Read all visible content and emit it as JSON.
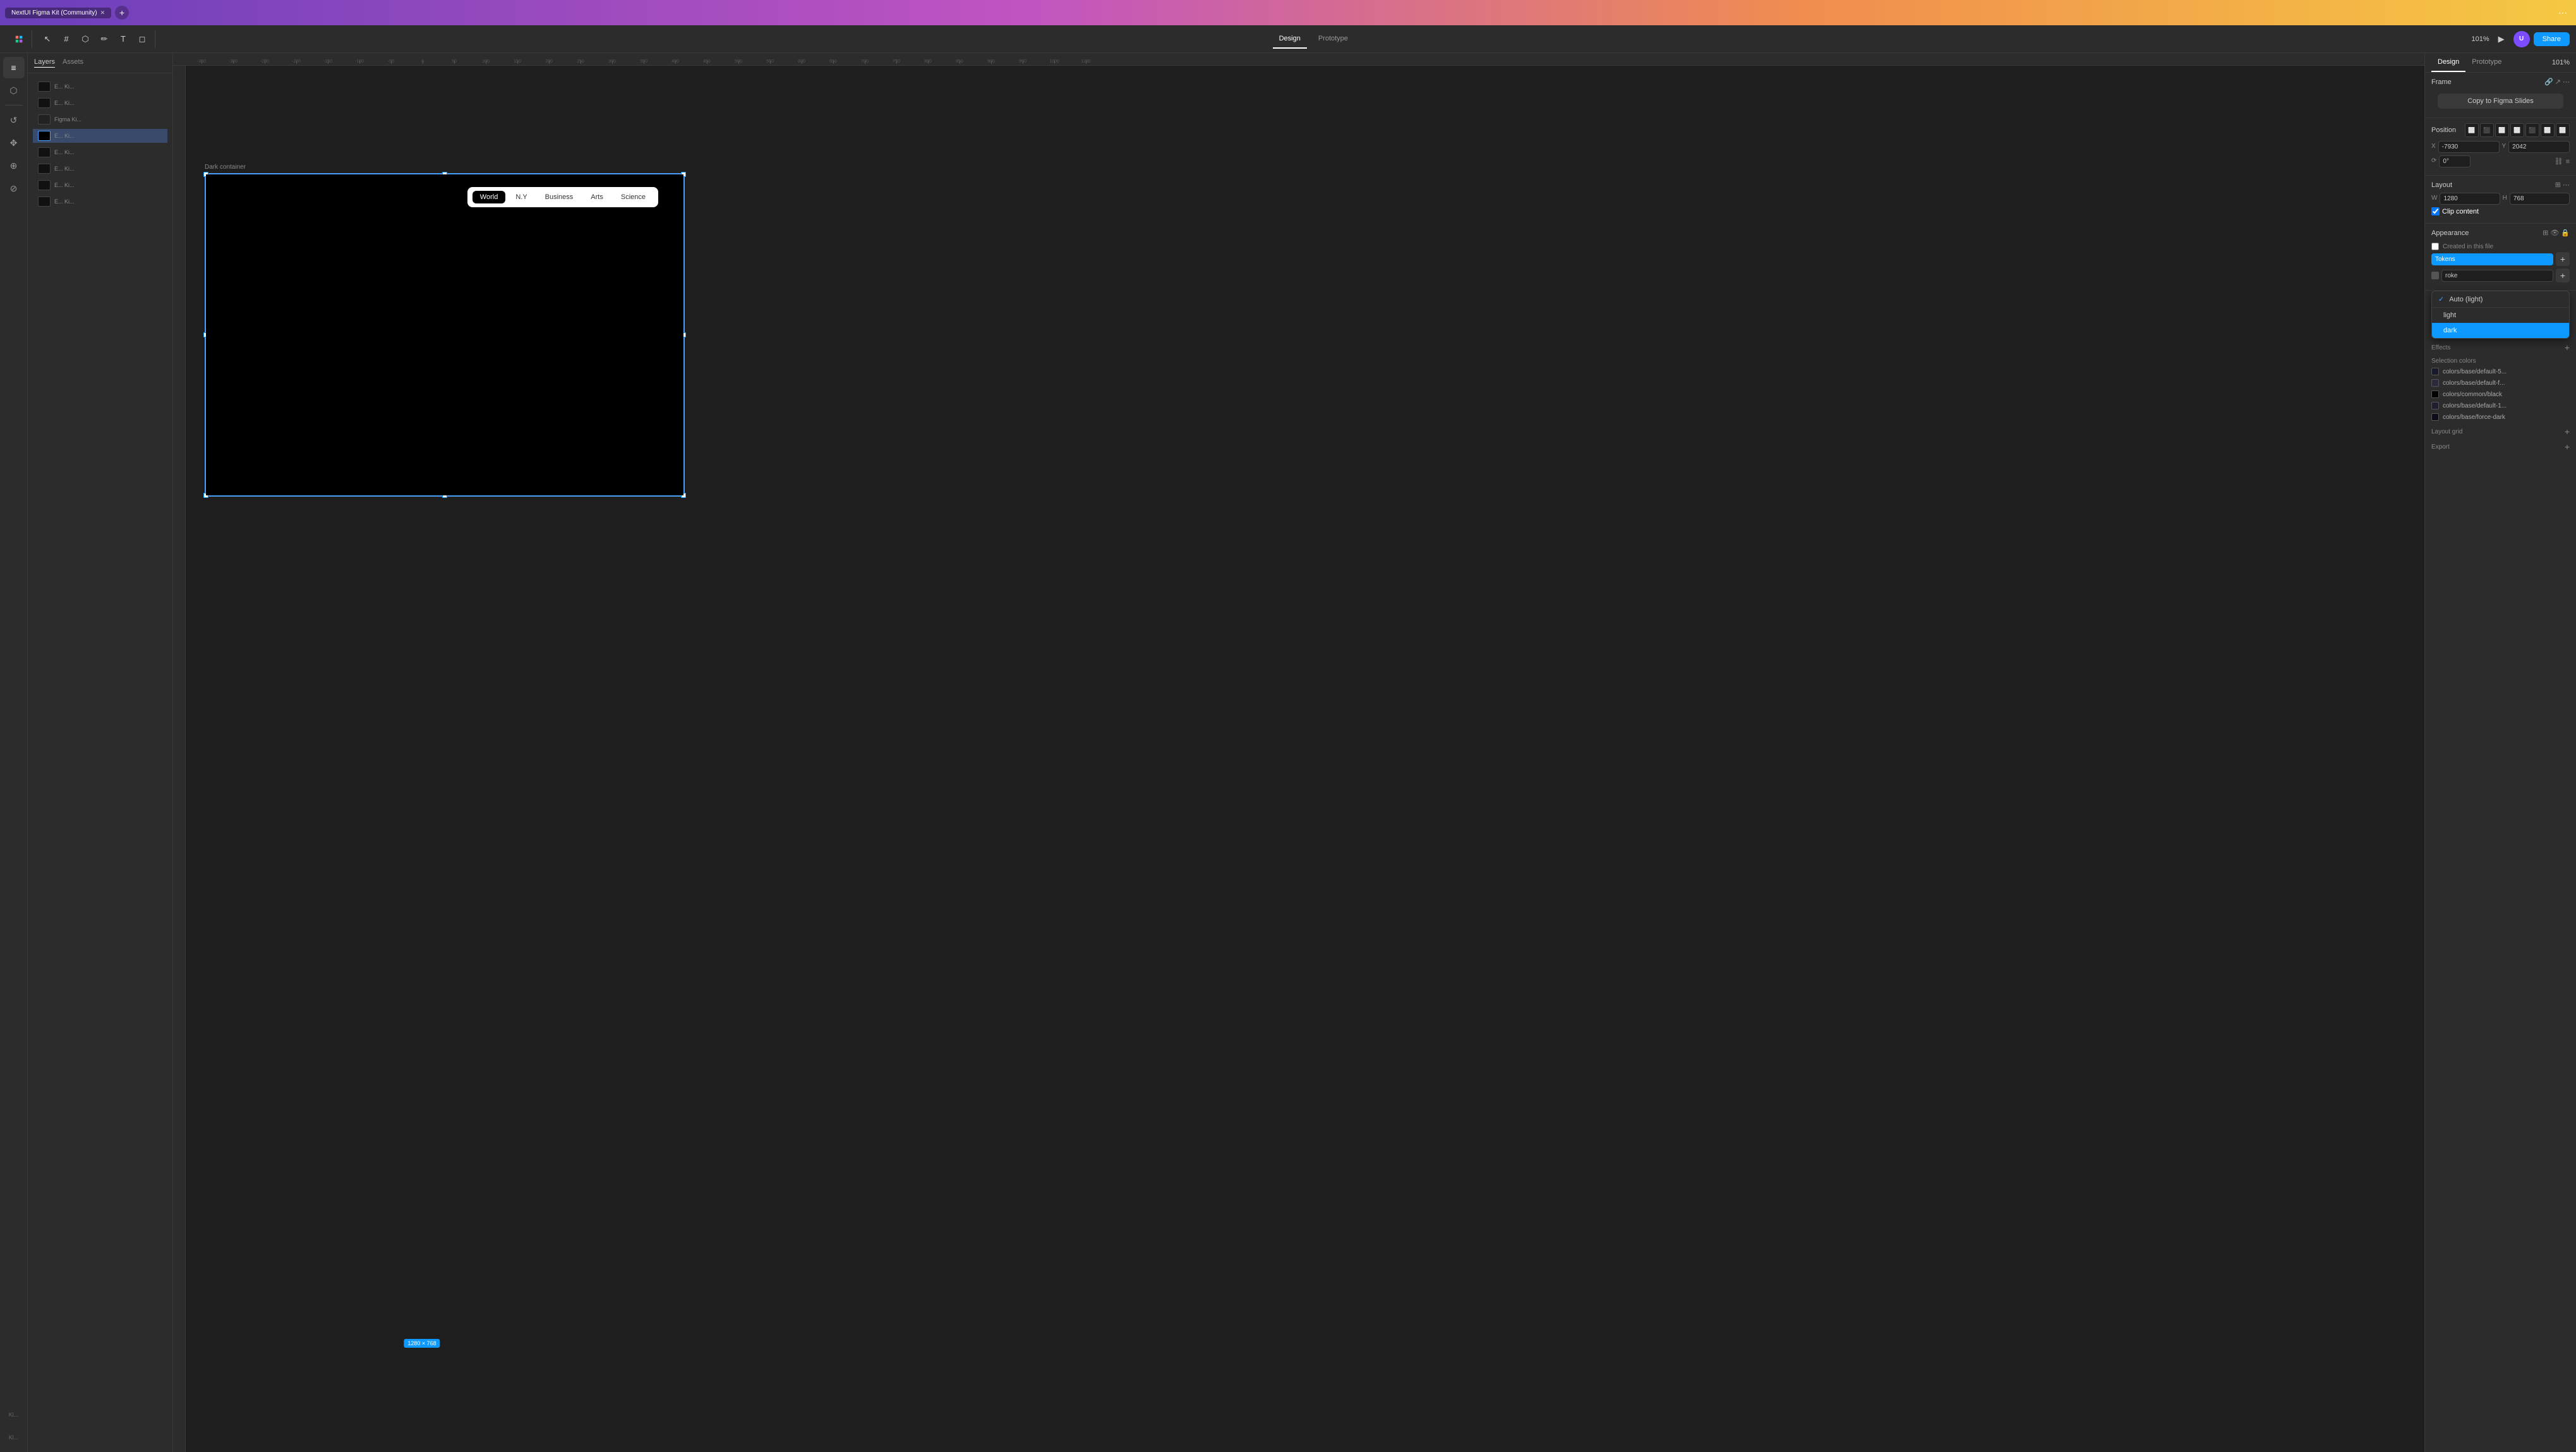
{
  "window": {
    "title": "NextUI Figma Kit (Community)",
    "tab_label": "NextUI Figma Kit (Community)",
    "close_icon": "✕",
    "add_tab_icon": "+"
  },
  "toolbar": {
    "share_label": "Share",
    "zoom_label": "101%",
    "play_icon": "▶",
    "design_tab": "Design",
    "prototype_tab": "Prototype",
    "more_icon": "⋯"
  },
  "left_sidebar": {
    "icons": [
      "≡",
      "⬡",
      "◻",
      "T",
      "✏",
      "⬜"
    ],
    "sub_icons": [
      "↺",
      "✥",
      "⊕",
      "⊘"
    ]
  },
  "layers": {
    "tabs": [
      "Layers",
      "Assets"
    ],
    "items": [
      {
        "label": "E... Ki...",
        "selected": false,
        "thumb": "dark"
      },
      {
        "label": "E... Ki...",
        "selected": false,
        "thumb": "dark"
      },
      {
        "label": "Figma Ki...",
        "selected": false,
        "thumb": "dark"
      },
      {
        "label": "E... Ki...",
        "selected": false,
        "thumb": "dark"
      },
      {
        "label": "E... Ki...",
        "selected": false,
        "thumb": "dark"
      },
      {
        "label": "E... Ki...",
        "selected": true,
        "thumb": "black"
      },
      {
        "label": "E... Ki...",
        "selected": false,
        "thumb": "dark"
      },
      {
        "label": "E... Ki...",
        "selected": false,
        "thumb": "dark"
      }
    ]
  },
  "canvas": {
    "frame_label": "Dark container",
    "frame_size": "1280 × 768",
    "nav_tabs": [
      "World",
      "N.Y",
      "Business",
      "Arts",
      "Science"
    ],
    "active_nav_tab": "World"
  },
  "ruler": {
    "marks": [
      "-350",
      "-300",
      "-250",
      "-200",
      "-150",
      "-100",
      "-50",
      "0",
      "50",
      "100",
      "150",
      "200",
      "250",
      "300",
      "350",
      "400",
      "450",
      "500",
      "550",
      "600",
      "650",
      "700",
      "750",
      "800",
      "850",
      "900",
      "950",
      "1000",
      "1050",
      "1100",
      "1150",
      "1200",
      "1250",
      "1280"
    ]
  },
  "right_panel": {
    "tabs": [
      "Design",
      "Prototype"
    ],
    "zoom": "101%",
    "copy_figma_btn": "Copy to Figma Slides",
    "sections": {
      "frame_label": "Frame",
      "position": {
        "label": "Position",
        "x_label": "X",
        "x_value": "-7930",
        "y_label": "Y",
        "y_value": "2042",
        "rotation_label": "0°"
      },
      "layout": {
        "label": "Layout",
        "w_label": "W",
        "w_value": "1280",
        "h_label": "H",
        "h_value": "768",
        "clip_content": "Clip content"
      },
      "appearance": {
        "label": "Appearance",
        "created_info": "Created in this file",
        "token_input": "Tokens",
        "stroke_label": "roke"
      },
      "effects": {
        "label": "Effects"
      },
      "selection_colors": {
        "label": "Selection colors",
        "colors": [
          {
            "swatch": "#1a1a2e",
            "label": "colors/base/default-5..."
          },
          {
            "swatch": "#2a2a3e",
            "label": "colors/base/default-f..."
          },
          {
            "swatch": "#000000",
            "label": "colors/common/black"
          },
          {
            "swatch": "#1e1e2e",
            "label": "colors/base/default-1..."
          },
          {
            "swatch": "#0d0d1a",
            "label": "colors/base/force-dark"
          }
        ]
      },
      "layout_grid": {
        "label": "Layout grid"
      },
      "export": {
        "label": "Export"
      }
    },
    "dropdown": {
      "visible": true,
      "auto_light_option": "Auto (light)",
      "light_option": "light",
      "dark_option": "dark",
      "selected": "dark",
      "token_value": "Tokens"
    }
  }
}
